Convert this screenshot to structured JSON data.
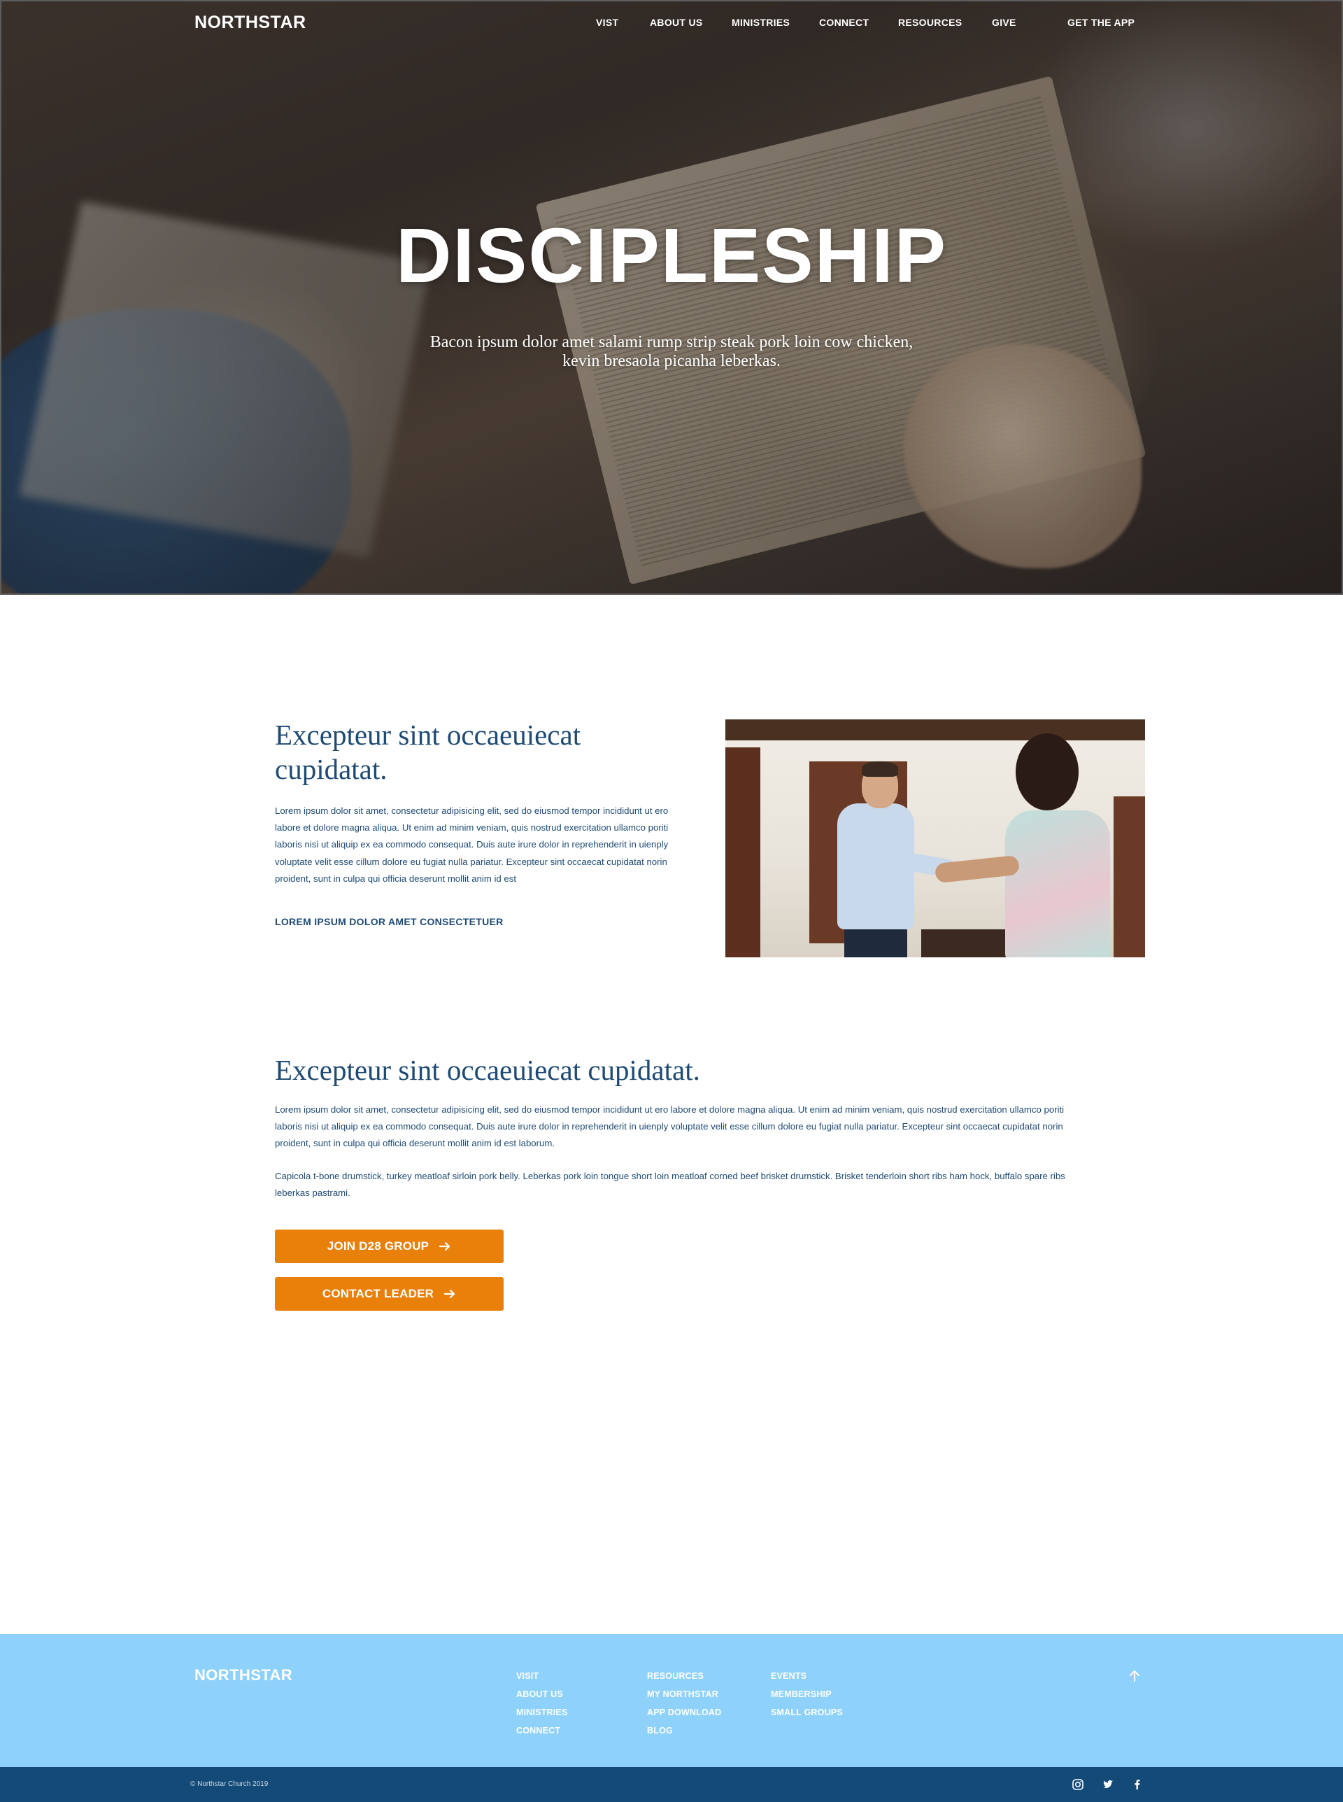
{
  "site": {
    "logo": "NORTHSTAR"
  },
  "nav": {
    "items": [
      {
        "label": "VIST"
      },
      {
        "label": "ABOUT US"
      },
      {
        "label": "MINISTRIES"
      },
      {
        "label": "CONNECT"
      },
      {
        "label": "RESOURCES"
      },
      {
        "label": "GIVE"
      }
    ],
    "cta": "GET THE APP"
  },
  "hero": {
    "title": "DISCIPLESHIP",
    "subtitle": "Bacon ipsum dolor amet salami rump strip steak pork loin cow chicken, kevin bresaola picanha leberkas."
  },
  "section1": {
    "heading": "Excepteur sint occaeuiecat cupidatat.",
    "body": "Lorem ipsum dolor sit amet, consectetur adipisicing elit, sed do eiusmod tempor incididunt ut ero labore et dolore magna aliqua. Ut enim ad minim veniam, quis nostrud exercitation ullamco poriti laboris nisi ut aliquip ex ea commodo consequat. Duis aute irure dolor in reprehenderit in uienply voluptate velit esse cillum dolore eu fugiat nulla pariatur. Excepteur sint occaecat cupidatat norin proident, sunt in culpa qui officia deserunt mollit anim id est",
    "link": "LOREM IPSUM DOLOR AMET CONSECTETUER"
  },
  "section2": {
    "heading": "Excepteur sint occaeuiecat cupidatat.",
    "paragraph1": "Lorem ipsum dolor sit amet, consectetur adipisicing elit, sed do eiusmod tempor incididunt ut ero labore et dolore magna aliqua. Ut enim ad minim veniam, quis nostrud exercitation ullamco poriti laboris nisi ut aliquip ex ea commodo consequat. Duis aute irure dolor in reprehenderit in uienply voluptate velit esse cillum dolore eu fugiat nulla pariatur. Excepteur sint occaecat cupidatat norin proident, sunt in culpa qui officia deserunt mollit anim id est laborum.",
    "paragraph2": "Capicola t-bone drumstick, turkey meatloaf sirloin pork belly. Leberkas pork loin tongue short loin meatloaf corned beef brisket drumstick. Brisket tenderloin short ribs ham hock, buffalo spare ribs leberkas pastrami.",
    "buttons": {
      "join": "JOIN D28 GROUP",
      "contact": "CONTACT LEADER"
    }
  },
  "footer": {
    "logo": "NORTHSTAR",
    "columns": [
      [
        "VISIT",
        "ABOUT US",
        "MINISTRIES",
        "CONNECT"
      ],
      [
        "RESOURCES",
        "MY NORTHSTAR",
        "APP DOWNLOAD",
        "BLOG"
      ],
      [
        "EVENTS",
        "MEMBERSHIP",
        "SMALL GROUPS"
      ]
    ],
    "copyright": "© Northstar Church 2019",
    "social": [
      "instagram-icon",
      "twitter-icon",
      "facebook-icon"
    ]
  },
  "colors": {
    "heading_blue": "#1e4a73",
    "accent_orange": "#e8800a",
    "footer_light_blue": "#8ed2fb",
    "footer_dark_blue": "#144a78"
  }
}
